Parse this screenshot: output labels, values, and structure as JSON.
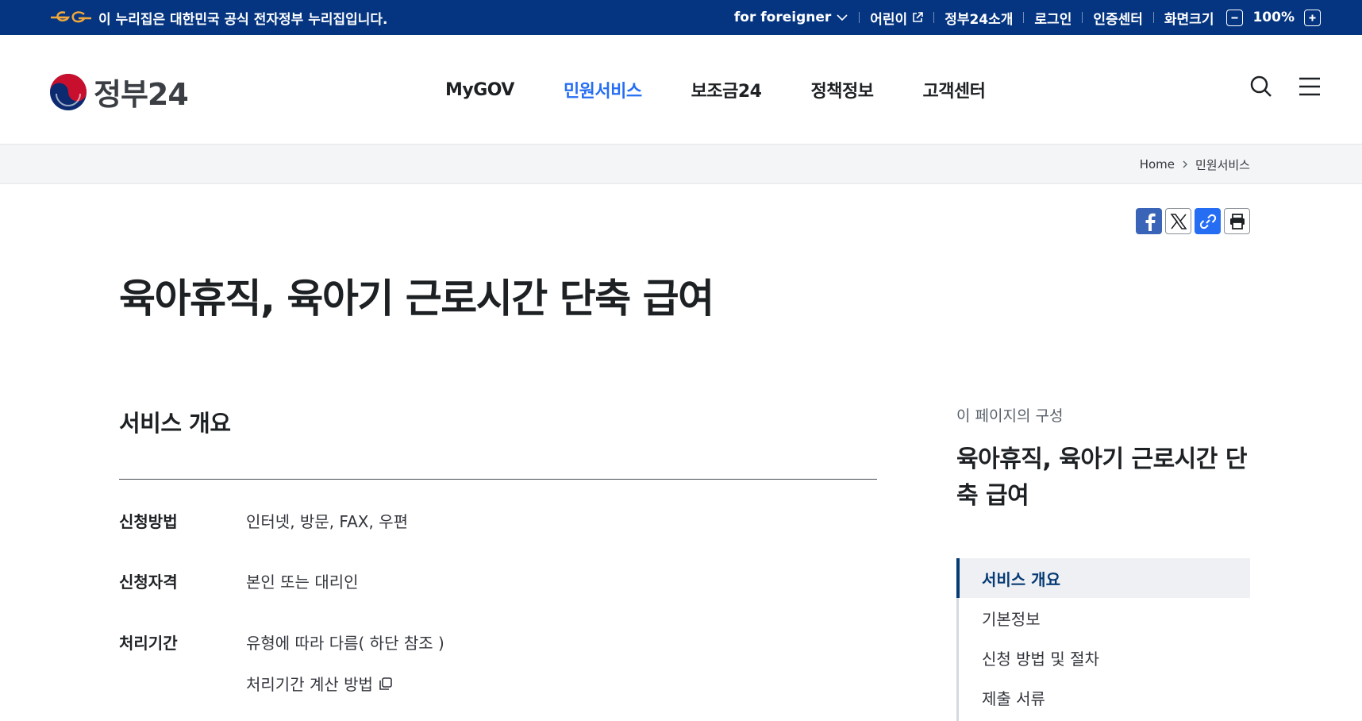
{
  "gov_banner": {
    "notice": "이 누리집은 대한민국 공식 전자정부 누리집입니다.",
    "utilities": {
      "foreigner": "for foreigner",
      "kids": "어린이",
      "about": "정부24소개",
      "login": "로그인",
      "cert": "인증센터",
      "screen_size": "화면크기",
      "zoom": "100%"
    }
  },
  "header": {
    "logo_text": "정부24",
    "nav": [
      "MyGOV",
      "민원서비스",
      "보조금24",
      "정책정보",
      "고객센터"
    ],
    "active_nav": "민원서비스"
  },
  "breadcrumb": {
    "home": "Home",
    "current": "민원서비스"
  },
  "page": {
    "title": "육아휴직, 육아기 근로시간 단축 급여"
  },
  "overview": {
    "heading": "서비스 개요",
    "rows": [
      {
        "label": "신청방법",
        "value": "인터넷, 방문, FAX, 우편"
      },
      {
        "label": "신청자격",
        "value": "본인 또는 대리인"
      },
      {
        "label": "처리기간",
        "value": "유형에 따라 다름( 하단 참조 )"
      }
    ],
    "calc_link": "처리기간 계산 방법"
  },
  "toc": {
    "caption": "이 페이지의 구성",
    "title": "육아휴직, 육아기 근로시간 단축 급여",
    "items": [
      "서비스 개요",
      "기본정보",
      "신청 방법 및 절차",
      "제출 서류"
    ],
    "active": "서비스 개요"
  },
  "icons": {
    "eg_logo": "e-government-logo",
    "external": "external-link-icon",
    "chevron": "chevron-down-icon",
    "search": "search-icon",
    "menu": "hamburger-menu-icon",
    "share": [
      "facebook-icon",
      "x-twitter-icon",
      "copy-link-icon",
      "print-icon"
    ]
  },
  "colors": {
    "banner": "#053581",
    "accent": "#256ef4",
    "toc_active": "#063a74"
  }
}
